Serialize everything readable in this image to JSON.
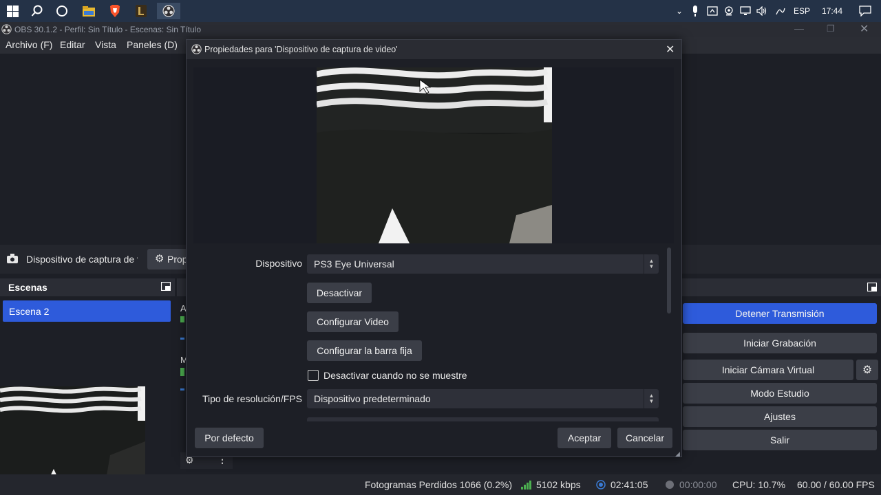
{
  "taskbar": {
    "tray_language": "ESP",
    "tray_time": "17:44"
  },
  "window": {
    "title": "OBS 30.1.2 - Perfil: Sin Título - Escenas: Sin Título"
  },
  "menu": {
    "items": [
      {
        "label": "Archivo (F)"
      },
      {
        "label": "Editar"
      },
      {
        "label": "Vista"
      },
      {
        "label": "Paneles (D)"
      }
    ]
  },
  "source_toolbar": {
    "source_name": "Dispositivo de captura de v",
    "properties_label": "Prop"
  },
  "scenes_dock": {
    "title": "Escenas",
    "items": [
      {
        "label": "Escena 2",
        "selected": true
      }
    ]
  },
  "mixer_stub": {
    "row1_letter": "A",
    "row2_letter": "M"
  },
  "controls": {
    "stop_stream": "Detener Transmisión",
    "start_recording": "Iniciar Grabación",
    "start_virtual_cam": "Iniciar Cámara Virtual",
    "studio_mode": "Modo Estudio",
    "settings": "Ajustes",
    "exit": "Salir"
  },
  "statusbar": {
    "dropped_frames": "Fotogramas Perdidos 1066 (0.2%)",
    "bitrate": "5102 kbps",
    "stream_time": "02:41:05",
    "record_time": "00:00:00",
    "cpu": "CPU: 10.7%",
    "fps": "60.00 / 60.00 FPS"
  },
  "dialog": {
    "title": "Propiedades para 'Dispositivo de captura de video'",
    "device_label": "Dispositivo",
    "device_value": "PS3 Eye Universal",
    "deactivate_button": "Desactivar",
    "configure_video_button": "Configurar Video",
    "configure_crossbar_button": "Configurar la barra fija",
    "deactivate_when_hidden": "Desactivar cuando no se muestre",
    "deactivate_when_hidden_checked": false,
    "resolution_label": "Tipo de resolución/FPS",
    "resolution_value": "Dispositivo predeterminado",
    "defaults_button": "Por defecto",
    "ok_button": "Aceptar",
    "cancel_button": "Cancelar"
  },
  "colors": {
    "accent": "#2e5bdb",
    "panel_bg": "#1d1f26",
    "button_bg": "#3b3e47"
  }
}
